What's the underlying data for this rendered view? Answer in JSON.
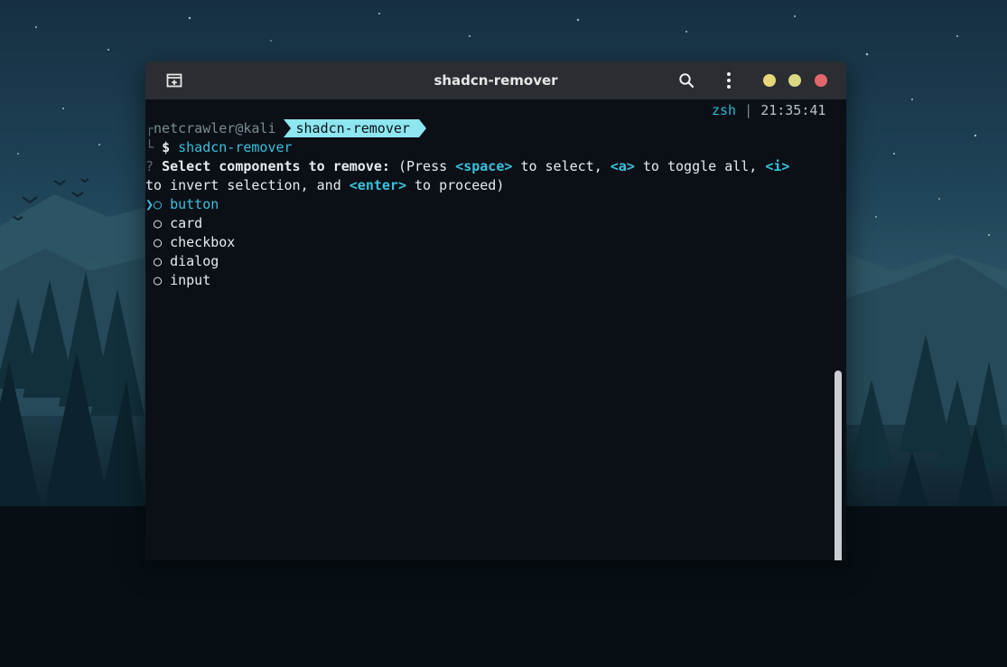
{
  "window": {
    "title": "shadcn-remover"
  },
  "prompt": {
    "right_shell": "zsh",
    "right_separator": "|",
    "right_time": "21:35:41",
    "bracket_top": "┌",
    "bracket_bottom": "└",
    "user_host": "netcrawler@kali",
    "directory": "shadcn-remover",
    "symbol": "$",
    "command": "shadcn-remover"
  },
  "question": {
    "marker": "?",
    "text": "Select components to remove:",
    "hint_open": "(Press",
    "key_space": "<space>",
    "hint_select": "to select,",
    "key_a": "<a>",
    "hint_toggle": "to toggle all,",
    "key_i": "<i>",
    "hint_invert": "to invert selection, and",
    "key_enter": "<enter>",
    "hint_proceed": "to proceed)"
  },
  "options": {
    "pointer": "❯",
    "bullet": "○",
    "items": [
      "button",
      "card",
      "checkbox",
      "dialog",
      "input"
    ]
  },
  "colors": {
    "accent": "#38c1de",
    "badge": "#8ee6f0",
    "close": "#e4666b",
    "minimize": "#e8d77a",
    "maximize": "#d9d883",
    "titlebar": "#2a2e33",
    "terminal_bg": "#0a1016"
  },
  "icons": {
    "new_tab": "new-tab-icon",
    "search": "search-icon",
    "menu": "kebab-menu-icon"
  }
}
